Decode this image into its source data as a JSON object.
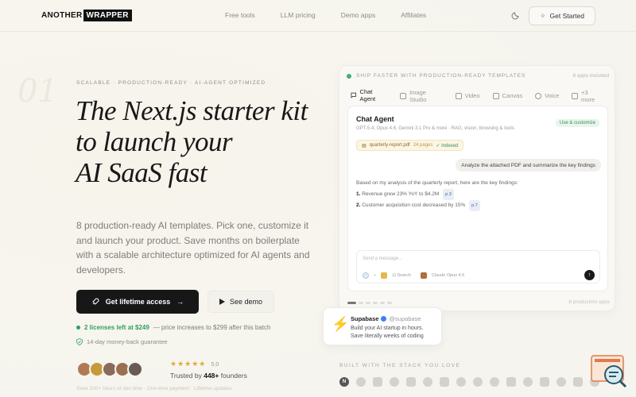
{
  "brand": {
    "part1": "ANOTHER",
    "part2": "WRAPPER"
  },
  "nav": {
    "links": [
      "Free tools",
      "LLM pricing",
      "Demo apps",
      "Affiliates"
    ],
    "cta": "Get Started",
    "cta_icon": "sparkle-icon",
    "theme_icon": "moon-icon"
  },
  "hero": {
    "number": "01",
    "eyebrow": "SCALABLE · PRODUCTION-READY · AI-AGENT OPTIMIZED",
    "headline": [
      "The Next.js starter kit",
      "to launch your",
      "AI SaaS fast"
    ],
    "subtitle": "8 production-ready AI templates. Pick one, customize it and launch your product. Save months on boilerplate with a scalable architecture optimized for AI agents and developers.",
    "primary_cta": "Get lifetime access",
    "secondary_cta": "See demo",
    "licenses_highlight": "2 licenses left at $249",
    "licenses_rest": "— price increases to $299 after this batch",
    "guarantee": "14-day money-back guarantee",
    "stars": "★★★★★",
    "rating": "5.0",
    "trusted_prefix": "Trusted by",
    "trusted_count": "448+",
    "trusted_suffix": "founders",
    "footnote": "Save 200+ hours of dev time · One-time payment · Lifetime updates"
  },
  "showcase": {
    "banner": "SHIP FASTER WITH PRODUCTION-READY TEMPLATES",
    "apps_included": "8 apps included",
    "tabs": [
      {
        "label": "Chat Agent",
        "icon": "chat-icon",
        "active": true
      },
      {
        "label": "Image Studio",
        "icon": "image-icon",
        "active": false
      },
      {
        "label": "Video",
        "icon": "video-icon",
        "active": false
      },
      {
        "label": "Canvas",
        "icon": "canvas-icon",
        "active": false
      },
      {
        "label": "Voice",
        "icon": "mic-icon",
        "active": false
      },
      {
        "label": "+3 more",
        "icon": "grid-icon",
        "active": false
      }
    ],
    "chat": {
      "title": "Chat Agent",
      "models": "GPT-5.4, Opus 4.6, Gemini 3.1 Pro & more · RAG, vision, browsing & tools",
      "badge": "Use & customize",
      "file_name": "quarterly-report.pdf",
      "file_pages": "24 pages",
      "file_status": "✓ Indexed",
      "user_message": "Analyze the attached PDF and summarize the key findings",
      "answer_intro": "Based on my analysis of the quarterly report, here are the key findings:",
      "answer_items": [
        {
          "n": "1.",
          "text": "Revenue grew 23% YoY to $4.2M",
          "cite": "p.3"
        },
        {
          "n": "2.",
          "text": "Customer acquisition cost decreased by 15%",
          "cite": "p.7"
        }
      ],
      "input_placeholder": "Send a message...",
      "tool_search": "Search",
      "model_selected": "Claude Opus 4.6"
    },
    "footer_count": "8 production apps"
  },
  "supabase": {
    "name": "Supabase",
    "handle": "@supabase",
    "line1": "Build your AI startup in hours.",
    "line2": "Save literally weeks of coding"
  },
  "stack": {
    "label": "BUILT WITH THE STACK YOU LOVE",
    "icons": [
      "nextjs-icon",
      "react-icon",
      "typescript-icon",
      "supabase-icon",
      "stripe-icon",
      "openai-icon",
      "anthropic-icon",
      "gemini-icon",
      "vercel-icon",
      "tailwind-icon",
      "resend-icon",
      "cloudflare-icon",
      "aws-icon",
      "replicate-icon",
      "deepseek-icon",
      "xai-icon"
    ]
  },
  "colors": {
    "accent_green": "#2f9f62",
    "star": "#e2a733",
    "primary_button": "#171717",
    "supabase": "#3ecf8e"
  }
}
